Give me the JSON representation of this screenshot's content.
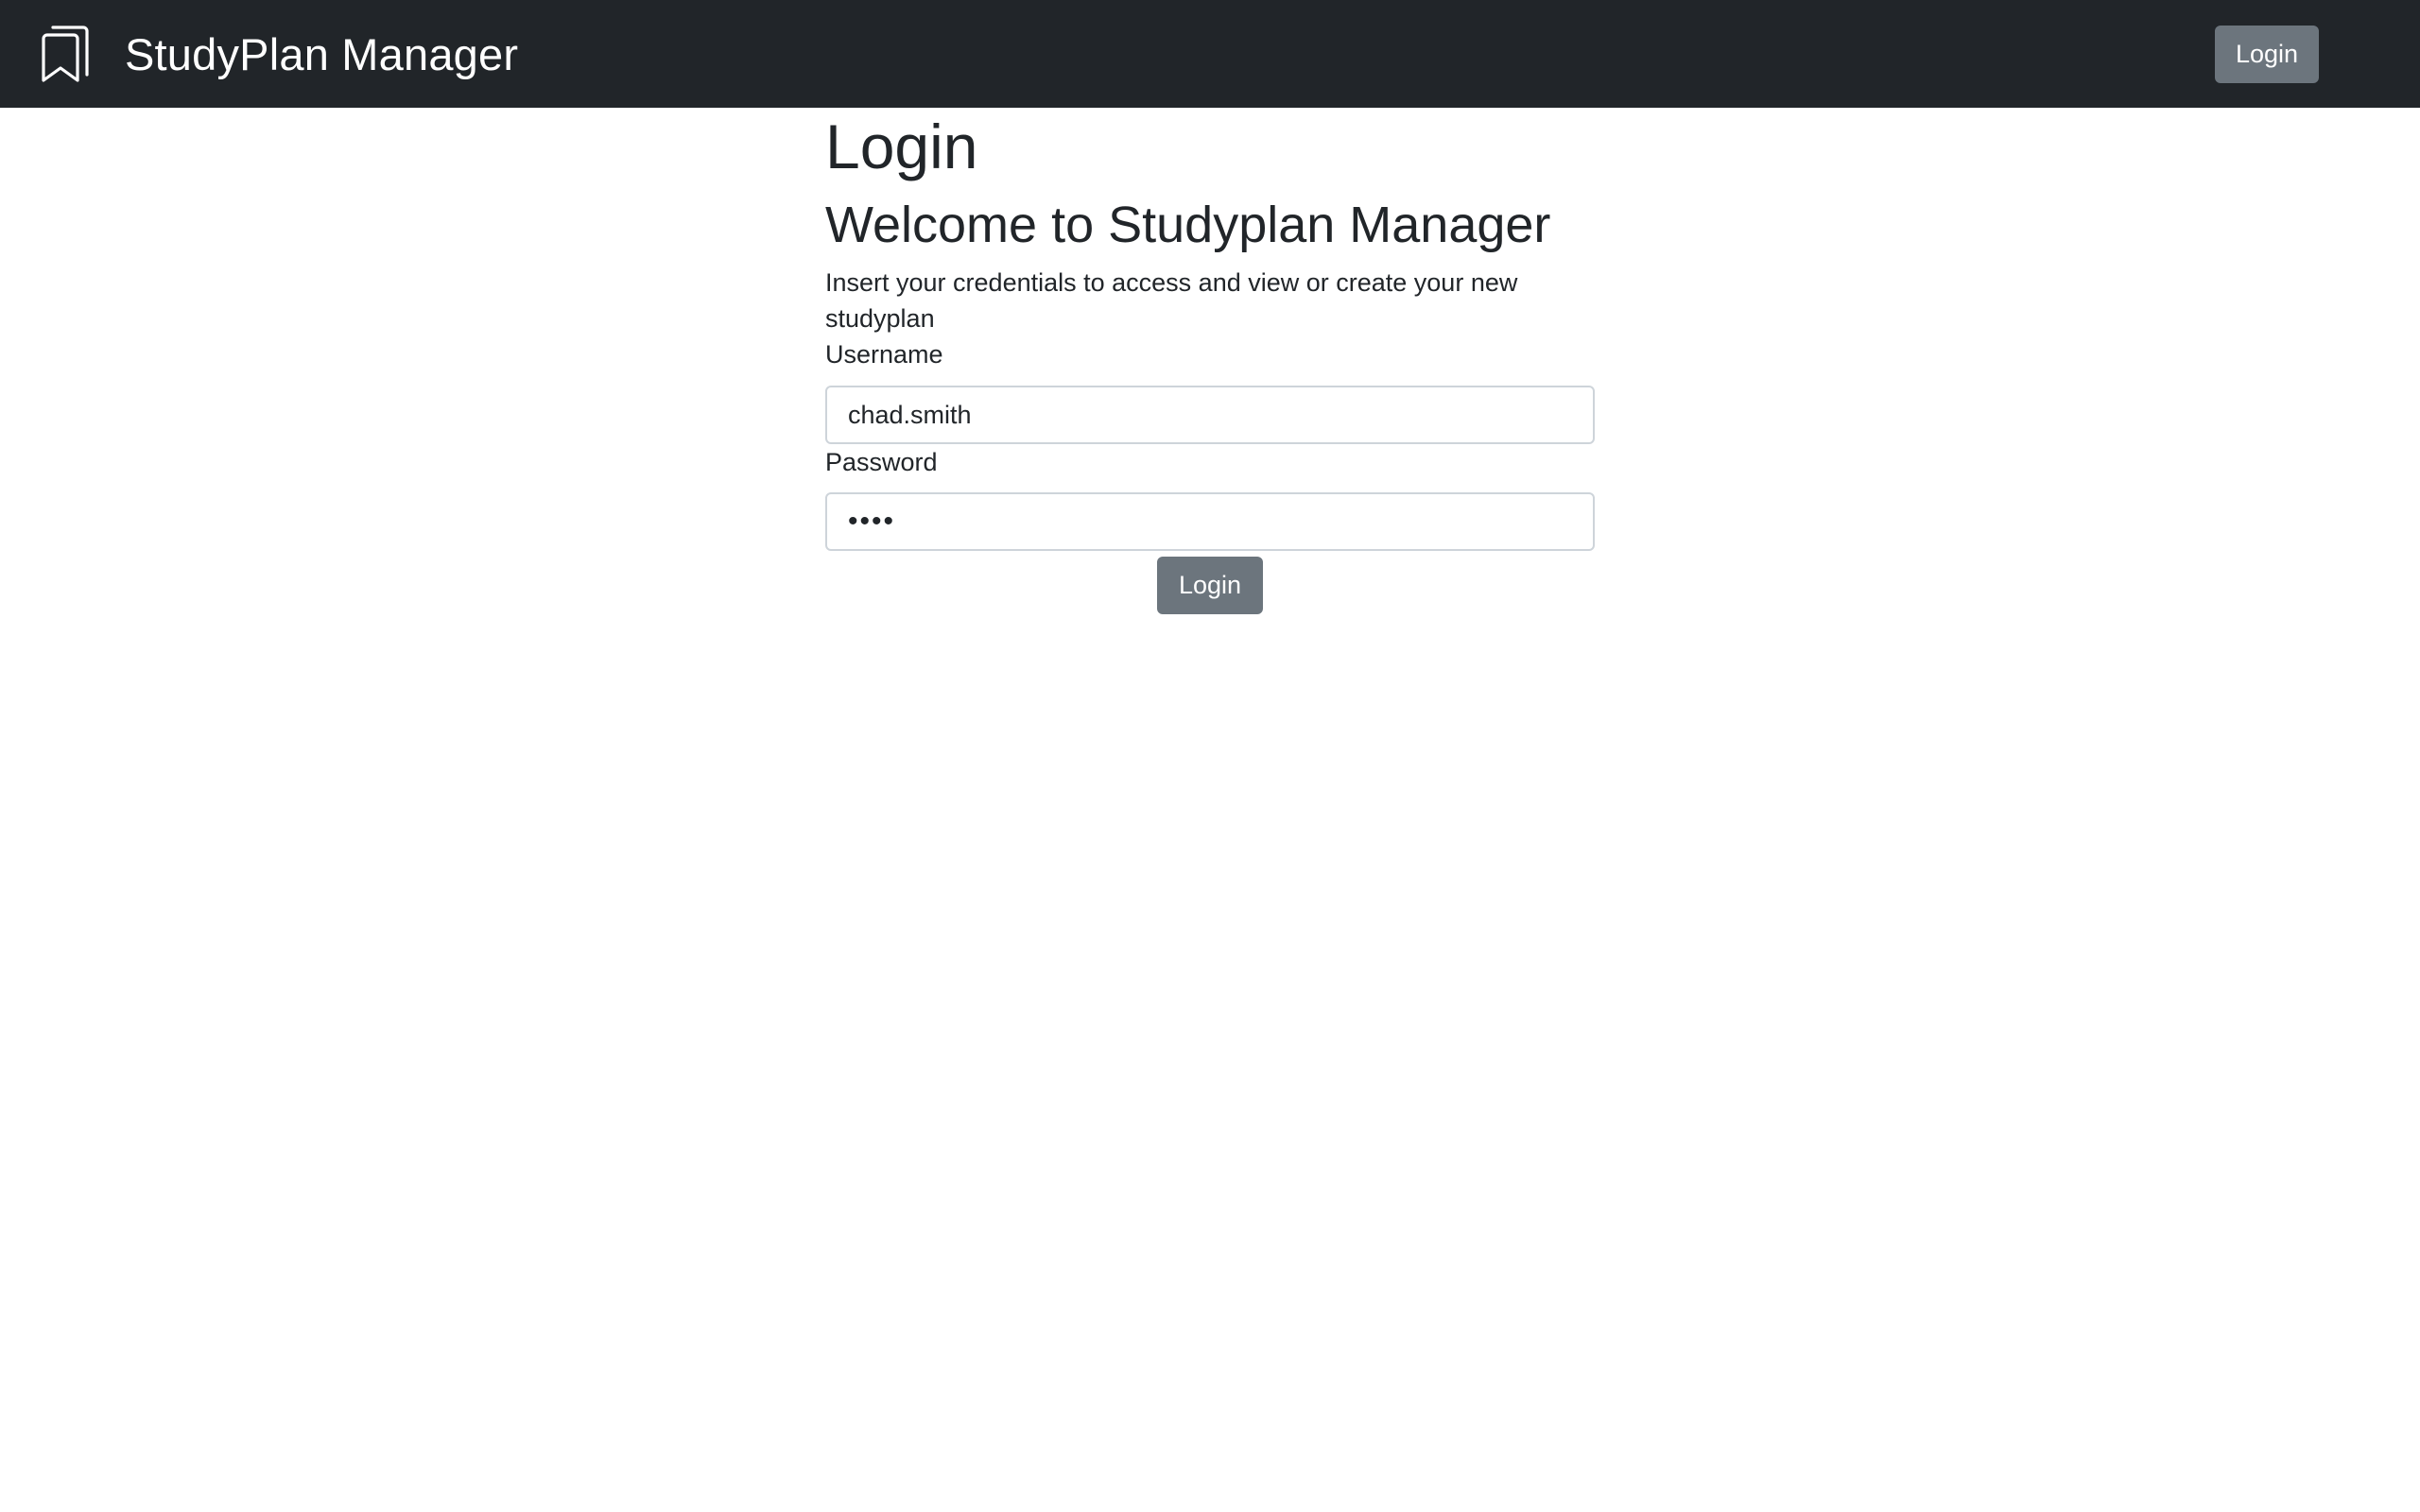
{
  "header": {
    "brand_title": "StudyPlan Manager",
    "brand_icon": "bookmarks-icon",
    "login_button_label": "Login",
    "background_color": "#212529"
  },
  "main": {
    "page_title": "Login",
    "welcome_heading": "Welcome to Studyplan Manager",
    "intro_text": "Insert your credentials to access and view or create your new studyplan",
    "username": {
      "label": "Username",
      "value": "chad.smith"
    },
    "password": {
      "label": "Password",
      "value": "••••"
    },
    "submit_label": "Login"
  },
  "colors": {
    "button": "#6c757d",
    "text": "#212529",
    "input_border": "#ced4da"
  }
}
